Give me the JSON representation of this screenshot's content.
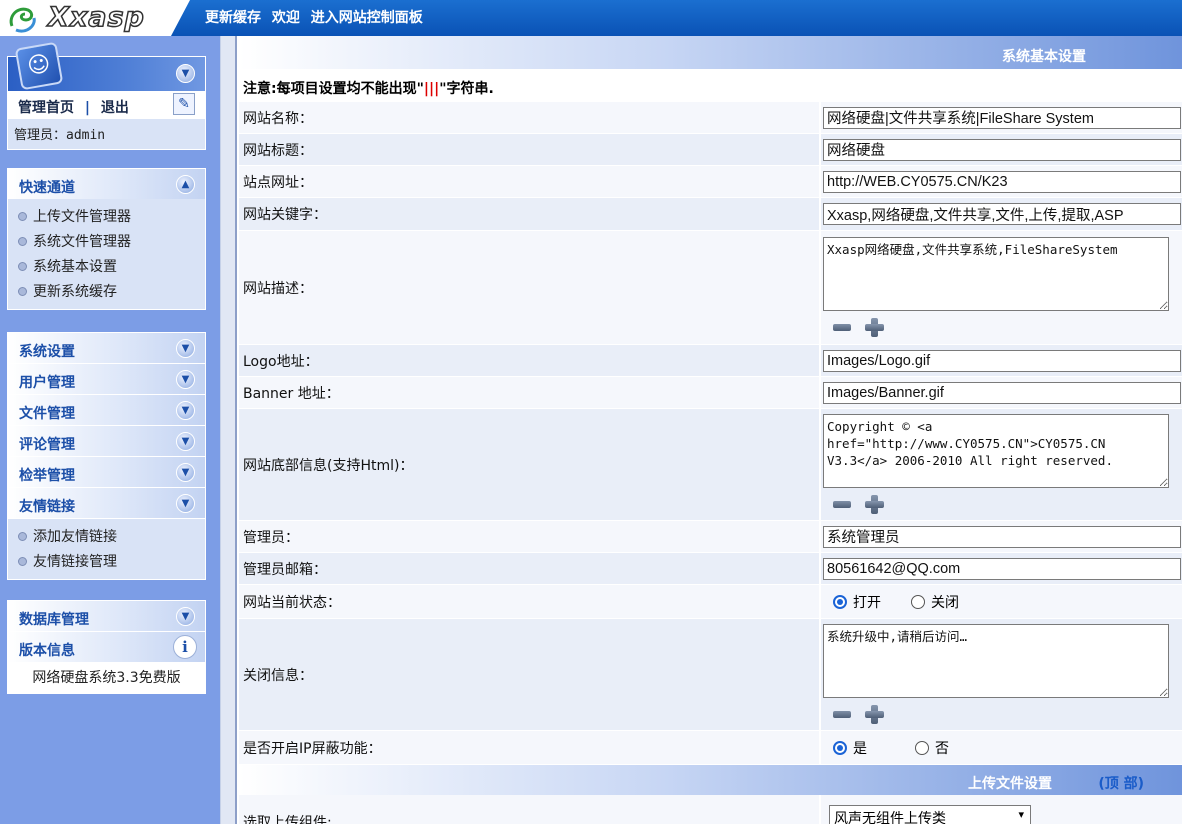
{
  "topbar": {
    "logo_text": "Xxasp",
    "nav": [
      "更新缓存",
      "欢迎",
      "进入网站控制面板"
    ]
  },
  "sidebar": {
    "admin_panel": {
      "home_label": "管理首页",
      "separator": "|",
      "logout_label": "退出",
      "admin_info": "管理员：admin"
    },
    "quick": {
      "title": "快速通道",
      "items": [
        "上传文件管理器",
        "系统文件管理器",
        "系统基本设置",
        "更新系统缓存"
      ]
    },
    "menus": [
      "系统设置",
      "用户管理",
      "文件管理",
      "评论管理",
      "检举管理"
    ],
    "links": {
      "title": "友情链接",
      "items": [
        "添加友情链接",
        "友情链接管理"
      ]
    },
    "database": {
      "title": "数据库管理"
    },
    "version": {
      "title": "版本信息",
      "text": "网络硬盘系统3.3免费版"
    }
  },
  "main": {
    "section1_title": "系统基本设置",
    "notice": {
      "prefix": "注意:每项目设置均不能出现\"",
      "bars": "|||",
      "suffix": "\"字符串."
    },
    "fields": {
      "site_name": {
        "label": "网站名称：",
        "value": "网络硬盘|文件共享系统|FileShare System"
      },
      "site_title": {
        "label": "网站标题：",
        "value": "网络硬盘"
      },
      "site_url": {
        "label": "站点网址：",
        "value": "http://WEB.CY0575.CN/K23"
      },
      "keywords": {
        "label": "网站关键字：",
        "value": "Xxasp,网络硬盘,文件共享,文件,上传,提取,ASP"
      },
      "description": {
        "label": "网站描述：",
        "value": "Xxasp网络硬盘,文件共享系统,FileShareSystem"
      },
      "logo": {
        "label": "Logo地址：",
        "value": "Images/Logo.gif"
      },
      "banner": {
        "label": "Banner 地址：",
        "value": "Images/Banner.gif"
      },
      "footer": {
        "label": "网站底部信息(支持Html)：",
        "value": "Copyright © <a href=\"http://www.CY0575.CN\">CY0575.CN V3.3</a> 2006-2010 All right reserved."
      },
      "admin": {
        "label": "管理员：",
        "value": "系统管理员"
      },
      "admin_email": {
        "label": "管理员邮箱：",
        "value": "80561642@QQ.com"
      },
      "status": {
        "label": "网站当前状态：",
        "options": [
          "打开",
          "关闭"
        ],
        "selected": "打开"
      },
      "close_msg": {
        "label": "关闭信息：",
        "value": "系统升级中,请稍后访问…"
      },
      "ip_block": {
        "label": "是否开启IP屏蔽功能：",
        "options": [
          "是",
          "否"
        ],
        "selected": "是"
      }
    },
    "section2_title": "上传文件设置",
    "top_link": "(顶 部)",
    "upload": {
      "label": "选取上传组件:",
      "selected_value": "风声无组件上传类"
    }
  },
  "colors": {
    "topbar": "#0a52b5",
    "sidebar_bg": "#7c9de6",
    "accent": "#1c4fa8",
    "warning": "#dd0000"
  }
}
